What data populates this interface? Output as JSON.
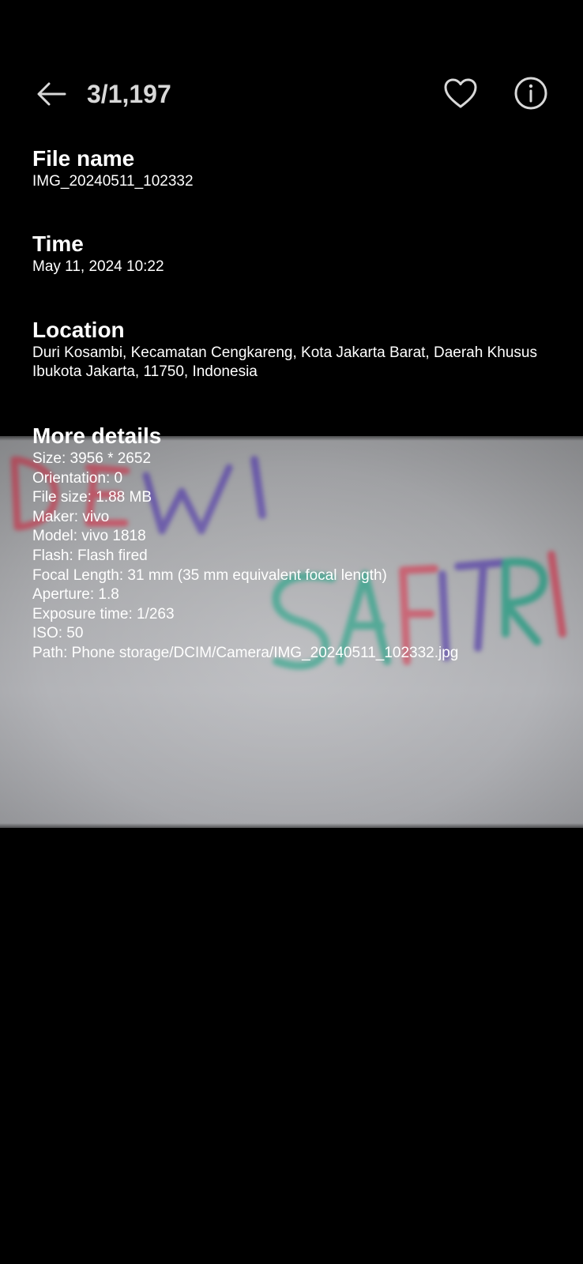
{
  "header": {
    "counter": "3/1,197"
  },
  "file": {
    "title": "File name",
    "value": "IMG_20240511_102332"
  },
  "time": {
    "title": "Time",
    "value": "May 11, 2024 10:22"
  },
  "location": {
    "title": "Location",
    "value": "Duri Kosambi, Kecamatan Cengkareng, Kota Jakarta Barat, Daerah Khusus Ibukota Jakarta, 11750, Indonesia"
  },
  "more": {
    "title": "More details",
    "lines": [
      "Size: 3956 * 2652",
      "Orientation: 0",
      "File size: 1.88 MB",
      "Maker: vivo",
      "Model: vivo 1818",
      "Flash: Flash fired",
      "Focal Length: 31 mm (35 mm equivalent focal length)",
      "Aperture: 1.8",
      "Exposure time: 1/263",
      "ISO: 50",
      "Path: Phone storage/DCIM/Camera/IMG_20240511_102332.jpg"
    ]
  },
  "photo": {
    "handwriting_line1": "DEWI",
    "handwriting_line2": "SAFITRI"
  },
  "icons": {
    "back": "arrow-left-icon",
    "favorite": "heart-icon",
    "info": "info-icon"
  },
  "colors": {
    "background": "#000000",
    "text": "#ffffff",
    "counter": "#d8d8d8"
  }
}
